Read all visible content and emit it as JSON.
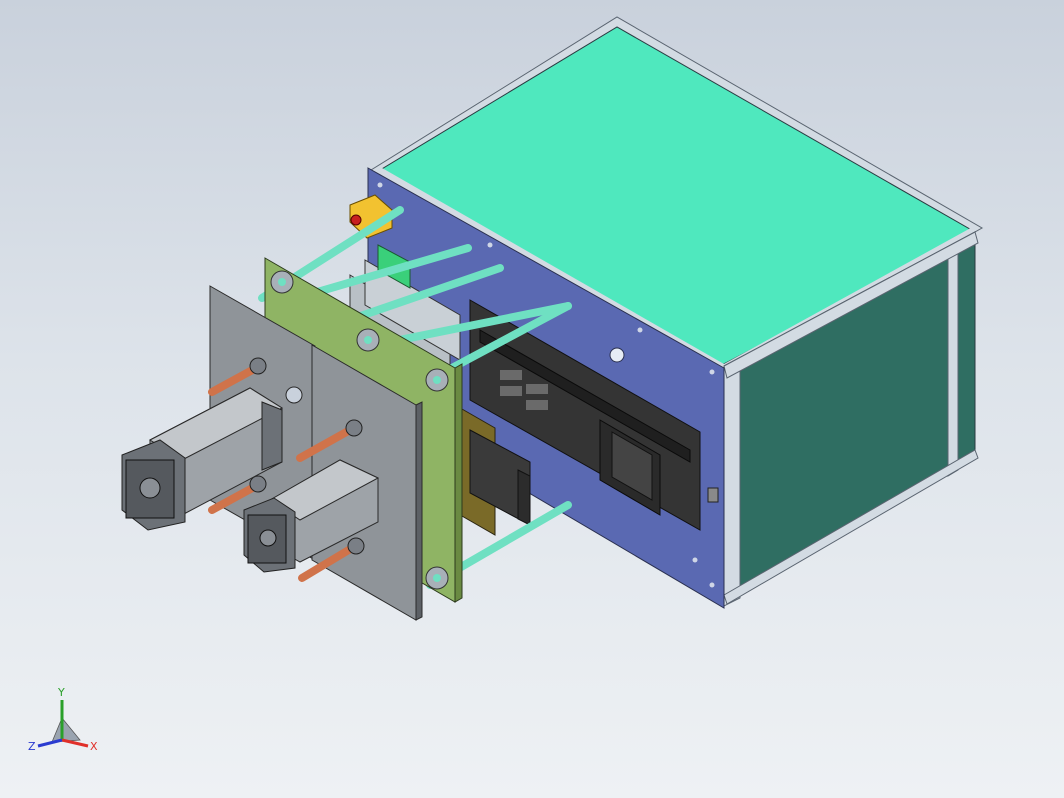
{
  "viewport": {
    "background_top": "#c9d1dc",
    "background_bottom": "#eef1f4"
  },
  "model": {
    "colors": {
      "top_panel": "#4fe8be",
      "side_panel": "#2f6e62",
      "frame": "#d3dbe3",
      "front_plate": "#5a69b2",
      "gray_plate": "#8f9499",
      "green_plate": "#8fb464",
      "rod": "#6fe0c2",
      "copper_rod": "#d0734a",
      "cylinder": "#9ea3a8",
      "dark_slide": "#343434",
      "olive_block": "#7a6a28",
      "warning_yellow": "#f2c230"
    }
  },
  "triad": {
    "x_label": "X",
    "y_label": "Y",
    "z_label": "Z",
    "x_color": "#e0302a",
    "y_color": "#2aa02a",
    "z_color": "#2a3bd0"
  }
}
